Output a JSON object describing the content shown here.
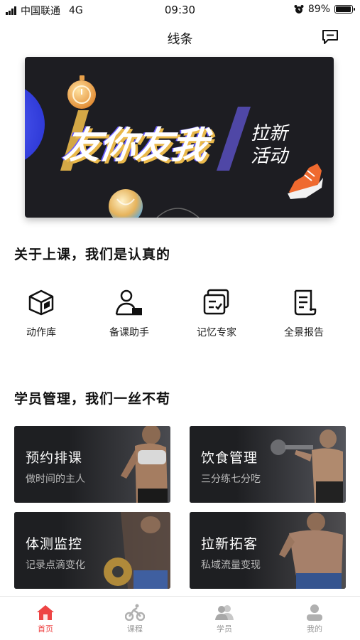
{
  "status_bar": {
    "carrier": "中国联通",
    "network": "4G",
    "time": "09:30",
    "battery_percent": "89%",
    "battery_level": 0.89,
    "alarm_icon": "alarm-clock-icon"
  },
  "nav": {
    "title": "线条",
    "message_icon": "message-icon"
  },
  "banner": {
    "main_text": "友你友我",
    "sub_text": "拉新活动"
  },
  "section1": {
    "title": "关于上课，我们是认真的",
    "tools": [
      {
        "label": "动作库",
        "icon": "box-icon"
      },
      {
        "label": "备课助手",
        "icon": "user-desk-icon"
      },
      {
        "label": "记忆专家",
        "icon": "memory-cards-icon"
      },
      {
        "label": "全景报告",
        "icon": "report-scroll-icon"
      }
    ]
  },
  "section2": {
    "title": "学员管理，我们一丝不苟",
    "cards": [
      {
        "title": "预约排课",
        "subtitle": "做时间的主人"
      },
      {
        "title": "饮食管理",
        "subtitle": "三分练七分吃"
      },
      {
        "title": "体测监控",
        "subtitle": "记录点滴变化"
      },
      {
        "title": "拉新拓客",
        "subtitle": "私域流量变现"
      }
    ]
  },
  "tab_bar": {
    "tabs": [
      {
        "label": "首页",
        "icon": "home-icon",
        "active": true
      },
      {
        "label": "课程",
        "icon": "cycling-icon",
        "active": false
      },
      {
        "label": "学员",
        "icon": "students-icon",
        "active": false
      },
      {
        "label": "我的",
        "icon": "profile-icon",
        "active": false
      }
    ],
    "active_color": "#ee4444",
    "inactive_color": "#b0b0b0"
  }
}
